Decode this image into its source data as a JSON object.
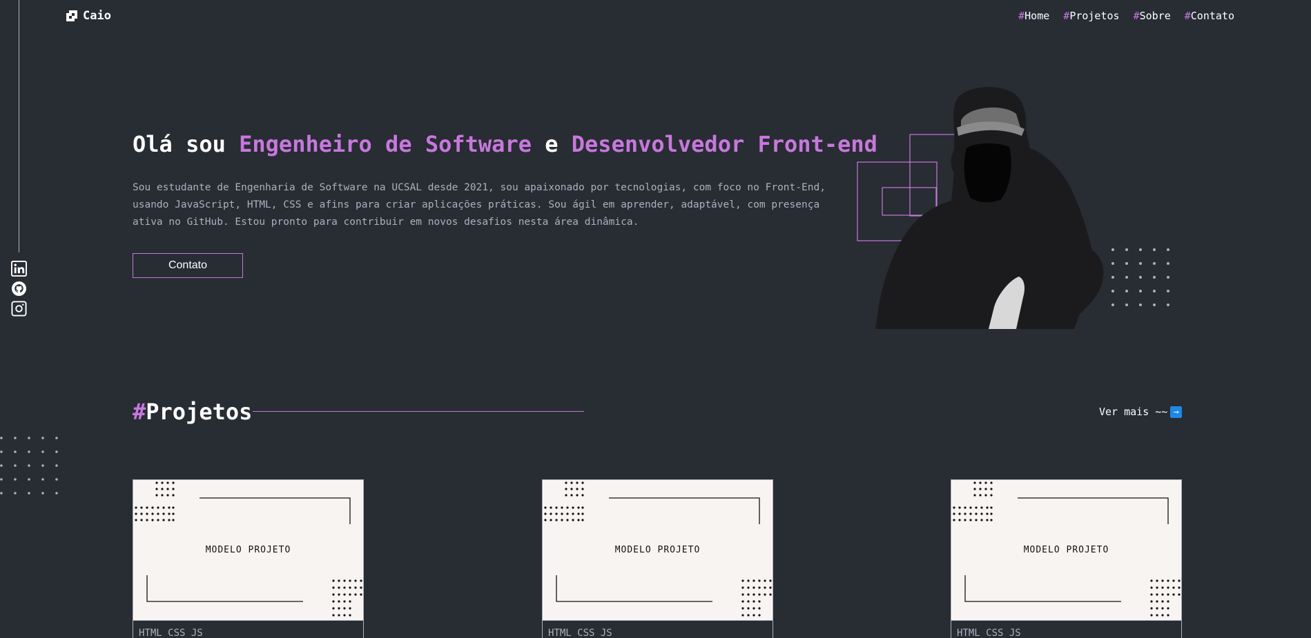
{
  "brand": {
    "name": "Caio"
  },
  "nav": [
    {
      "hash": "#",
      "label": "Home"
    },
    {
      "hash": "#",
      "label": "Projetos"
    },
    {
      "hash": "#",
      "label": "Sobre"
    },
    {
      "hash": "#",
      "label": "Contato"
    }
  ],
  "socials": [
    "linkedin-icon",
    "github-icon",
    "instagram-icon"
  ],
  "hero": {
    "title_part1": "Olá sou ",
    "title_accent1": "Engenheiro de Software",
    "title_part2": " e ",
    "title_accent2": "Desenvolvedor Front-end",
    "description": "Sou estudante de Engenharia de Software na UCSAL desde 2021, sou apaixonado por tecnologias, com foco no Front-End, usando JavaScript, HTML, CSS e afins para criar aplicações práticas. Sou ágil em aprender, adaptável, com presença ativa no GitHub. Estou pronto para contribuir em novos desafios nesta área dinâmica.",
    "contact_button": "Contato"
  },
  "projects": {
    "hash": "#",
    "title": "Projetos",
    "see_more": "Ver mais ~~",
    "see_more_icon": "arrow-right-icon",
    "cards": [
      {
        "image_label": "MODELO PROJETO",
        "tags": "HTML CSS JS"
      },
      {
        "image_label": "MODELO PROJETO",
        "tags": "HTML CSS JS"
      },
      {
        "image_label": "MODELO PROJETO",
        "tags": "HTML CSS JS"
      }
    ]
  },
  "colors": {
    "background": "#282c33",
    "accent": "#c778dd",
    "text": "#ffffff",
    "muted": "#abb2bf",
    "card_image_bg": "#f8f4f2"
  }
}
